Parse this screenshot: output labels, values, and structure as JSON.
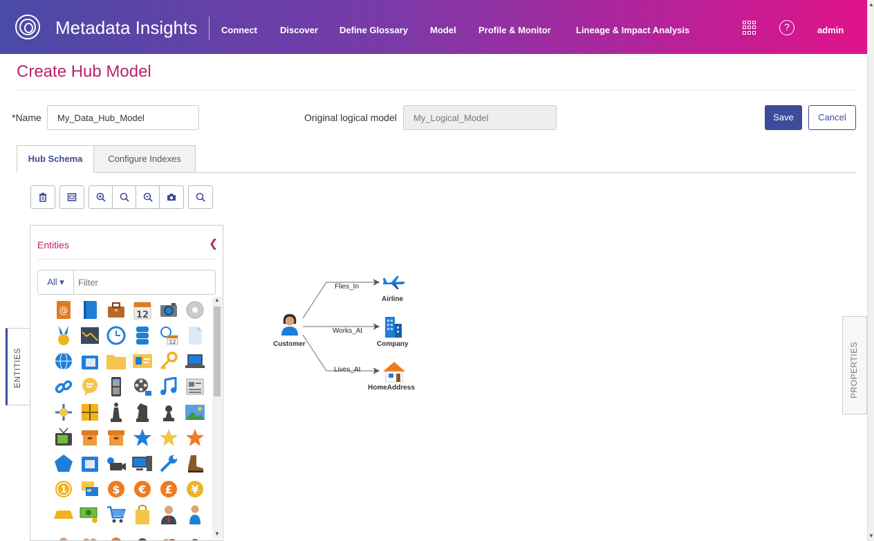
{
  "app": {
    "title": "Metadata Insights",
    "user": "admin"
  },
  "nav": [
    {
      "label": "Connect"
    },
    {
      "label": "Discover"
    },
    {
      "label": "Define Glossary"
    },
    {
      "label": "Model"
    },
    {
      "label": "Profile & Monitor"
    },
    {
      "label": "Lineage & Impact Analysis"
    }
  ],
  "page": {
    "title": "Create Hub Model"
  },
  "form": {
    "name_label": "*Name",
    "name_value": "My_Data_Hub_Model",
    "logical_label": "Original logical model",
    "logical_value": "My_Logical_Model",
    "save_label": "Save",
    "cancel_label": "Cancel"
  },
  "tabs": [
    {
      "label": "Hub Schema",
      "active": true
    },
    {
      "label": "Configure Indexes",
      "active": false
    }
  ],
  "toolbar": {
    "icons": [
      "delete-icon",
      "fit-icon",
      "zoom-in-icon",
      "zoom-reset-icon",
      "zoom-out-icon",
      "camera-icon",
      "search-icon"
    ]
  },
  "entities": {
    "header": "Entities",
    "filter_dropdown": "All",
    "filter_placeholder": "Filter",
    "side_tab": "ENTITIES"
  },
  "properties": {
    "side_tab": "PROPERTIES"
  },
  "diagram": {
    "nodes": [
      {
        "id": "customer",
        "label": "Customer"
      },
      {
        "id": "airline",
        "label": "Airline"
      },
      {
        "id": "company",
        "label": "Company"
      },
      {
        "id": "homeaddress",
        "label": "HomeAddress"
      }
    ],
    "edges": [
      {
        "label": "Flies_In"
      },
      {
        "label": "Works_At"
      },
      {
        "label": "Lives_At"
      }
    ]
  },
  "colors": {
    "accent": "#3d4b9b",
    "brand": "#b8236e"
  }
}
